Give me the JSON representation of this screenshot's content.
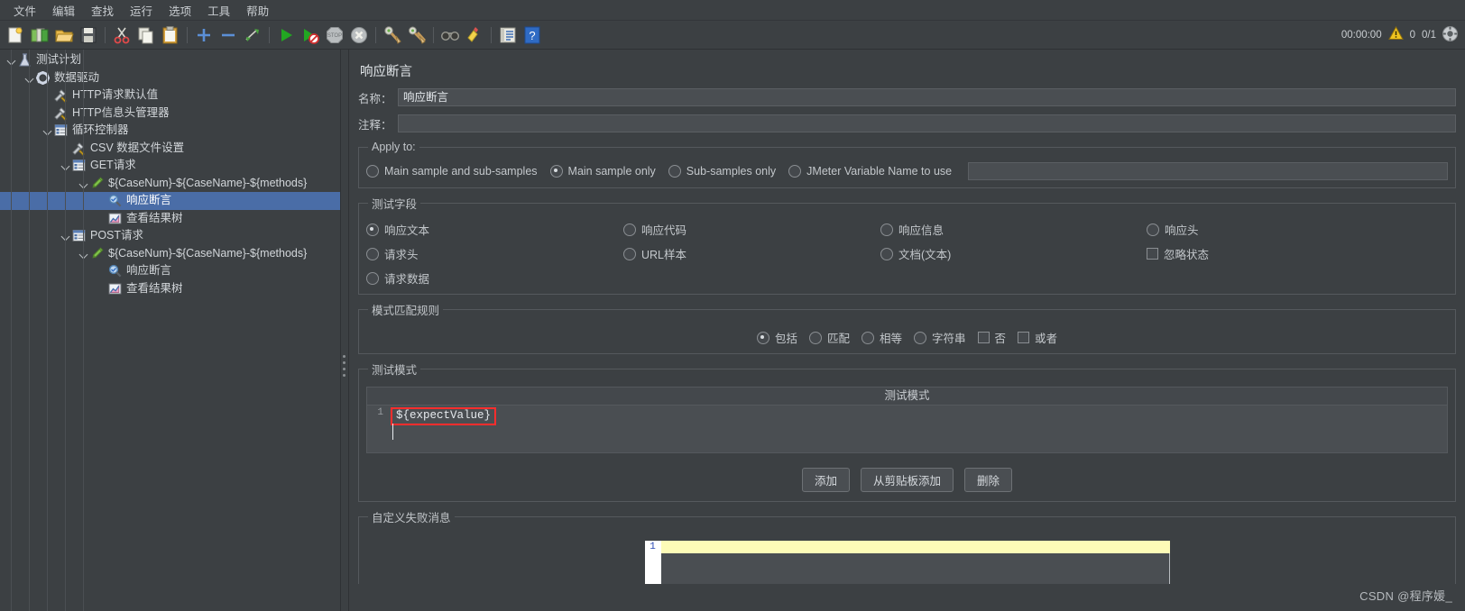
{
  "window": {
    "timer": "00:00:00",
    "warn_count": "0",
    "thread_count": "0/1"
  },
  "menubar": {
    "items": [
      {
        "label": "文件",
        "name": "menu-file"
      },
      {
        "label": "编辑",
        "name": "menu-edit"
      },
      {
        "label": "查找",
        "name": "menu-search"
      },
      {
        "label": "运行",
        "name": "menu-run"
      },
      {
        "label": "选项",
        "name": "menu-options"
      },
      {
        "label": "工具",
        "name": "menu-tools"
      },
      {
        "label": "帮助",
        "name": "menu-help"
      }
    ]
  },
  "toolbar": {
    "icons": [
      "new-file-icon",
      "templates-icon",
      "open-folder-icon",
      "save-icon",
      "cut-icon",
      "copy-icon",
      "paste-icon",
      "expand-all-icon",
      "collapse-all-icon",
      "toggle-icon",
      "start-icon",
      "start-no-timers-icon",
      "stop-icon",
      "shutdown-icon",
      "clear-icon",
      "clear-all-icon",
      "search-icon",
      "search-reset-icon",
      "function-helper-icon",
      "help-icon"
    ]
  },
  "tree": {
    "nodes": [
      {
        "label": "测试计划",
        "icon": "test-plan-icon",
        "depth": 0,
        "twisty": "open",
        "selected": false,
        "name": "tree-node-test-plan"
      },
      {
        "label": "数据驱动",
        "icon": "thread-group-icon",
        "depth": 1,
        "twisty": "open",
        "selected": false,
        "name": "tree-node-data-driven"
      },
      {
        "label": "HTTP请求默认值",
        "icon": "config-icon",
        "depth": 2,
        "twisty": "none",
        "selected": false,
        "name": "tree-node-http-defaults"
      },
      {
        "label": "HTTP信息头管理器",
        "icon": "config-icon",
        "depth": 2,
        "twisty": "none",
        "selected": false,
        "name": "tree-node-http-header-manager"
      },
      {
        "label": "循环控制器",
        "icon": "controller-icon",
        "depth": 2,
        "twisty": "open",
        "selected": false,
        "name": "tree-node-loop-controller"
      },
      {
        "label": "CSV 数据文件设置",
        "icon": "config-icon",
        "depth": 3,
        "twisty": "none",
        "selected": false,
        "name": "tree-node-csv-data-set"
      },
      {
        "label": "GET请求",
        "icon": "controller-icon",
        "depth": 3,
        "twisty": "open",
        "selected": false,
        "name": "tree-node-get-request"
      },
      {
        "label": "${CaseNum}-${CaseName}-${methods}",
        "icon": "sampler-icon",
        "depth": 4,
        "twisty": "open",
        "selected": false,
        "name": "tree-node-get-sampler"
      },
      {
        "label": "响应断言",
        "icon": "assertion-icon",
        "depth": 5,
        "twisty": "none",
        "selected": true,
        "name": "tree-node-response-assertion-get"
      },
      {
        "label": "查看结果树",
        "icon": "listener-icon",
        "depth": 5,
        "twisty": "none",
        "selected": false,
        "name": "tree-node-view-results-tree-get"
      },
      {
        "label": "POST请求",
        "icon": "controller-icon",
        "depth": 3,
        "twisty": "open",
        "selected": false,
        "name": "tree-node-post-request"
      },
      {
        "label": "${CaseNum}-${CaseName}-${methods}",
        "icon": "sampler-icon",
        "depth": 4,
        "twisty": "open",
        "selected": false,
        "name": "tree-node-post-sampler"
      },
      {
        "label": "响应断言",
        "icon": "assertion-icon",
        "depth": 5,
        "twisty": "none",
        "selected": false,
        "name": "tree-node-response-assertion-post"
      },
      {
        "label": "查看结果树",
        "icon": "listener-icon",
        "depth": 5,
        "twisty": "none",
        "selected": false,
        "name": "tree-node-view-results-tree-post"
      }
    ]
  },
  "panel": {
    "title": "响应断言",
    "name_label": "名称：",
    "name_value": "响应断言",
    "comment_label": "注释：",
    "comment_value": "",
    "apply_to": {
      "legend": "Apply to:",
      "options": [
        {
          "label": "Main sample and sub-samples",
          "selected": false,
          "name": "radio-main-and-sub"
        },
        {
          "label": "Main sample only",
          "selected": true,
          "name": "radio-main-only"
        },
        {
          "label": "Sub-samples only",
          "selected": false,
          "name": "radio-sub-only"
        },
        {
          "label": "JMeter Variable Name to use",
          "selected": false,
          "name": "radio-jmeter-variable"
        }
      ],
      "variable_value": ""
    },
    "test_field": {
      "legend": "测试字段",
      "options": [
        {
          "label": "响应文本",
          "selected": true,
          "type": "radio",
          "col": 0,
          "name": "radio-response-text"
        },
        {
          "label": "响应代码",
          "selected": false,
          "type": "radio",
          "col": 1,
          "name": "radio-response-code"
        },
        {
          "label": "响应信息",
          "selected": false,
          "type": "radio",
          "col": 2,
          "name": "radio-response-message"
        },
        {
          "label": "响应头",
          "selected": false,
          "type": "radio",
          "col": 3,
          "name": "radio-response-headers"
        },
        {
          "label": "请求头",
          "selected": false,
          "type": "radio",
          "col": 0,
          "name": "radio-request-headers"
        },
        {
          "label": "URL样本",
          "selected": false,
          "type": "radio",
          "col": 1,
          "name": "radio-url-sample"
        },
        {
          "label": "文档(文本)",
          "selected": false,
          "type": "radio",
          "col": 2,
          "name": "radio-document-text"
        },
        {
          "label": "忽略状态",
          "selected": false,
          "type": "check",
          "col": 3,
          "name": "checkbox-ignore-status"
        },
        {
          "label": "请求数据",
          "selected": false,
          "type": "radio",
          "col": 0,
          "name": "radio-request-data"
        }
      ]
    },
    "pattern_rules": {
      "legend": "模式匹配规则",
      "options": [
        {
          "label": "包括",
          "selected": true,
          "type": "radio",
          "name": "radio-contains"
        },
        {
          "label": "匹配",
          "selected": false,
          "type": "radio",
          "name": "radio-matches"
        },
        {
          "label": "相等",
          "selected": false,
          "type": "radio",
          "name": "radio-equals"
        },
        {
          "label": "字符串",
          "selected": false,
          "type": "radio",
          "name": "radio-substring"
        },
        {
          "label": "否",
          "selected": false,
          "type": "check",
          "name": "checkbox-not"
        },
        {
          "label": "或者",
          "selected": false,
          "type": "check",
          "name": "checkbox-or"
        }
      ]
    },
    "test_patterns": {
      "legend": "测试模式",
      "column_header": "测试模式",
      "rows": [
        {
          "line_number": "1",
          "value": "${expectValue}"
        }
      ],
      "buttons": [
        {
          "label": "添加",
          "name": "add-pattern-button"
        },
        {
          "label": "从剪贴板添加",
          "name": "add-from-clipboard-button"
        },
        {
          "label": "删除",
          "name": "delete-pattern-button"
        }
      ]
    },
    "custom_fail_message": {
      "legend": "自定义失败消息",
      "line_number": "1",
      "value": ""
    }
  },
  "watermark": "CSDN @程序媛_"
}
